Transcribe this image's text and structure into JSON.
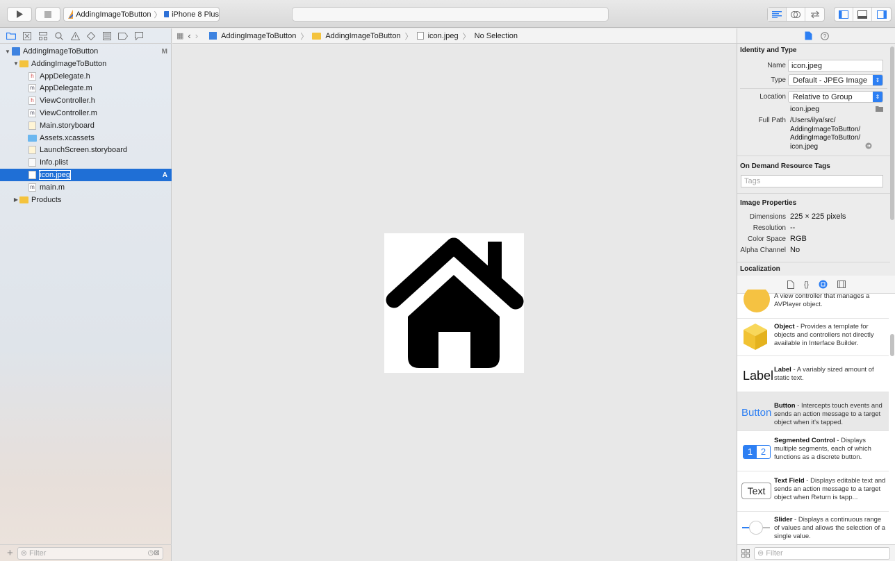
{
  "toolbar": {
    "scheme_project": "AddingImageToButton",
    "scheme_device": "iPhone 8 Plus"
  },
  "navigator": {
    "filter_placeholder": "Filter",
    "tree": [
      {
        "label": "AddingImageToButton",
        "badge": "M",
        "level": 0,
        "icon": "project-icon",
        "disclosure": "open"
      },
      {
        "label": "AddingImageToButton",
        "badge": "",
        "level": 1,
        "icon": "folder-icon",
        "disclosure": "open"
      },
      {
        "label": "AppDelegate.h",
        "badge": "",
        "level": 2,
        "icon": "header-file-icon"
      },
      {
        "label": "AppDelegate.m",
        "badge": "",
        "level": 2,
        "icon": "objc-file-icon"
      },
      {
        "label": "ViewController.h",
        "badge": "",
        "level": 2,
        "icon": "header-file-icon"
      },
      {
        "label": "ViewController.m",
        "badge": "",
        "level": 2,
        "icon": "objc-file-icon"
      },
      {
        "label": "Main.storyboard",
        "badge": "",
        "level": 2,
        "icon": "storyboard-icon"
      },
      {
        "label": "Assets.xcassets",
        "badge": "",
        "level": 2,
        "icon": "assets-folder-icon"
      },
      {
        "label": "LaunchScreen.storyboard",
        "badge": "",
        "level": 2,
        "icon": "storyboard-icon"
      },
      {
        "label": "Info.plist",
        "badge": "",
        "level": 2,
        "icon": "plist-icon"
      },
      {
        "label": "icon.jpeg",
        "badge": "A",
        "level": 2,
        "icon": "image-file-icon",
        "selected": true
      },
      {
        "label": "main.m",
        "badge": "",
        "level": 2,
        "icon": "objc-file-icon"
      },
      {
        "label": "Products",
        "badge": "",
        "level": 1,
        "icon": "folder-icon",
        "disclosure": "closed"
      }
    ]
  },
  "jumpbar": {
    "crumbs": [
      "AddingImageToButton",
      "AddingImageToButton",
      "icon.jpeg",
      "No Selection"
    ]
  },
  "inspector": {
    "identity": {
      "title": "Identity and Type",
      "name_label": "Name",
      "name_value": "icon.jpeg",
      "type_label": "Type",
      "type_value": "Default - JPEG Image",
      "location_label": "Location",
      "location_value": "Relative to Group",
      "location_file": "icon.jpeg",
      "fullpath_label": "Full Path",
      "fullpath_lines": [
        "/Users/ilya/src/",
        "AddingImageToButton/",
        "AddingImageToButton/",
        "icon.jpeg"
      ]
    },
    "odr": {
      "title": "On Demand Resource Tags",
      "placeholder": "Tags"
    },
    "image_props": {
      "title": "Image Properties",
      "rows": [
        {
          "label": "Dimensions",
          "value": "225 × 225 pixels"
        },
        {
          "label": "Resolution",
          "value": "--"
        },
        {
          "label": "Color Space",
          "value": "RGB"
        },
        {
          "label": "Alpha Channel",
          "value": "No"
        }
      ]
    },
    "localization": {
      "title": "Localization"
    }
  },
  "library": {
    "items": [
      {
        "title": "",
        "desc": "A view controller that manages a AVPlayer object.",
        "preview": "avplayer-icon"
      },
      {
        "title": "Object",
        "desc": " - Provides a template for objects and controllers not directly available in Interface Builder.",
        "preview": "object-cube-icon"
      },
      {
        "title": "Label",
        "desc": " - A variably sized amount of static text.",
        "preview_text": "Label"
      },
      {
        "title": "Button",
        "desc": " - Intercepts touch events and sends an action message to a target object when it's tapped.",
        "preview_text": "Button"
      },
      {
        "title": "Segmented Control",
        "desc": " - Displays multiple segments, each of which functions as a discrete button.",
        "preview_seg": [
          "1",
          "2"
        ]
      },
      {
        "title": "Text Field",
        "desc": " - Displays editable text and sends an action message to a target object when Return is tapp...",
        "preview_text": "Text"
      },
      {
        "title": "Slider",
        "desc": " - Displays a continuous range of values and allows the selection of a single value.",
        "preview": "slider-icon"
      }
    ],
    "filter_placeholder": "Filter"
  },
  "colors": {
    "selection": "#1f6fd6",
    "accent": "#2d7ff3",
    "canvas": "#e8e8e8"
  }
}
